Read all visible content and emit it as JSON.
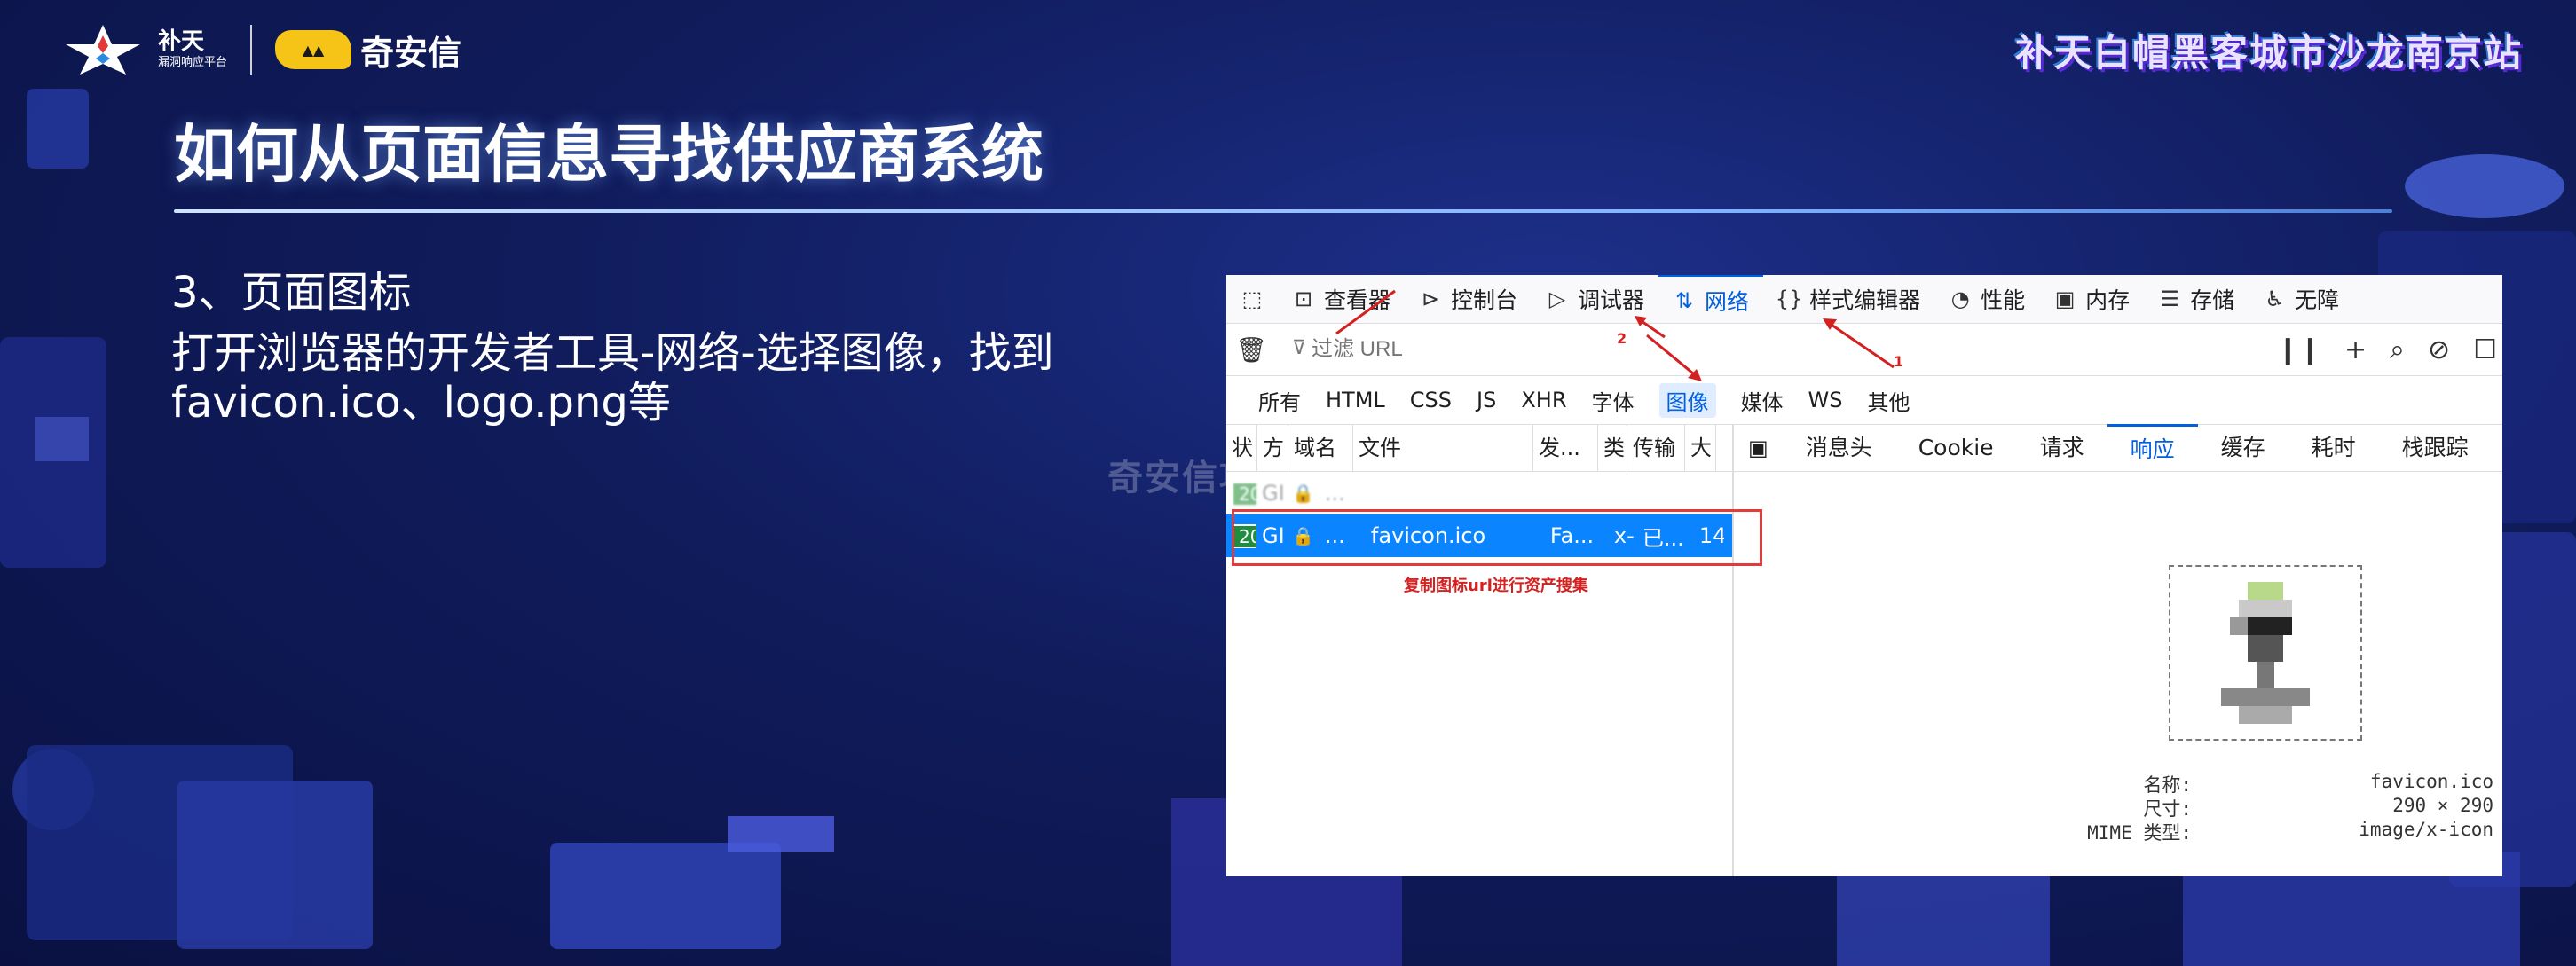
{
  "header": {
    "logo_main": "补天",
    "logo_sub": "漏洞响应平台",
    "qax_name": "奇安信",
    "event_title": "补天白帽黑客城市沙龙南京站"
  },
  "slide": {
    "title": "如何从页面信息寻找供应商系统",
    "subtitle": "3、页面图标",
    "desc_line1": "打开浏览器的开发者工具-网络-选择图像，找到",
    "desc_line2": "favicon.ico、logo.png等"
  },
  "watermark": "奇安信攻防社区",
  "devtools": {
    "tools": [
      {
        "label": "查看器",
        "icon": "inspector-icon"
      },
      {
        "label": "控制台",
        "icon": "console-icon"
      },
      {
        "label": "调试器",
        "icon": "debugger-icon"
      },
      {
        "label": "网络",
        "icon": "network-icon"
      },
      {
        "label": "样式编辑器",
        "icon": "style-editor-icon"
      },
      {
        "label": "性能",
        "icon": "performance-icon"
      },
      {
        "label": "内存",
        "icon": "memory-icon"
      },
      {
        "label": "存储",
        "icon": "storage-icon"
      },
      {
        "label": "无障",
        "icon": "accessibility-icon"
      }
    ],
    "active_tool": "网络",
    "filter_placeholder": "过滤 URL",
    "types": [
      "所有",
      "HTML",
      "CSS",
      "JS",
      "XHR",
      "字体",
      "图像",
      "媒体",
      "WS",
      "其他"
    ],
    "active_type": "图像",
    "req_headers": [
      "状",
      "方",
      "域名",
      "文件",
      "发...",
      "类",
      "传输",
      "大"
    ],
    "rows": [
      {
        "status": "200",
        "method": "GI",
        "domain": "...",
        "file": "",
        "initiator": "",
        "type": "",
        "transfer": "",
        "size": ""
      },
      {
        "status": "200",
        "method": "GI",
        "domain": "...",
        "file": "favicon.ico",
        "initiator": "Fa...",
        "type": "x-",
        "transfer": "已...",
        "size": "14"
      }
    ],
    "annotation": "复制图标url进行资产搜集",
    "arrow_1": "1",
    "arrow_2": "2",
    "resp_tabs": [
      "消息头",
      "Cookie",
      "请求",
      "响应",
      "缓存",
      "耗时",
      "栈跟踪"
    ],
    "active_resp_tab": "响应",
    "meta": [
      {
        "key": "名称:",
        "value": "favicon.ico"
      },
      {
        "key": "尺寸:",
        "value": "290 × 290"
      },
      {
        "key": "MIME 类型:",
        "value": "image/x-icon"
      }
    ]
  }
}
